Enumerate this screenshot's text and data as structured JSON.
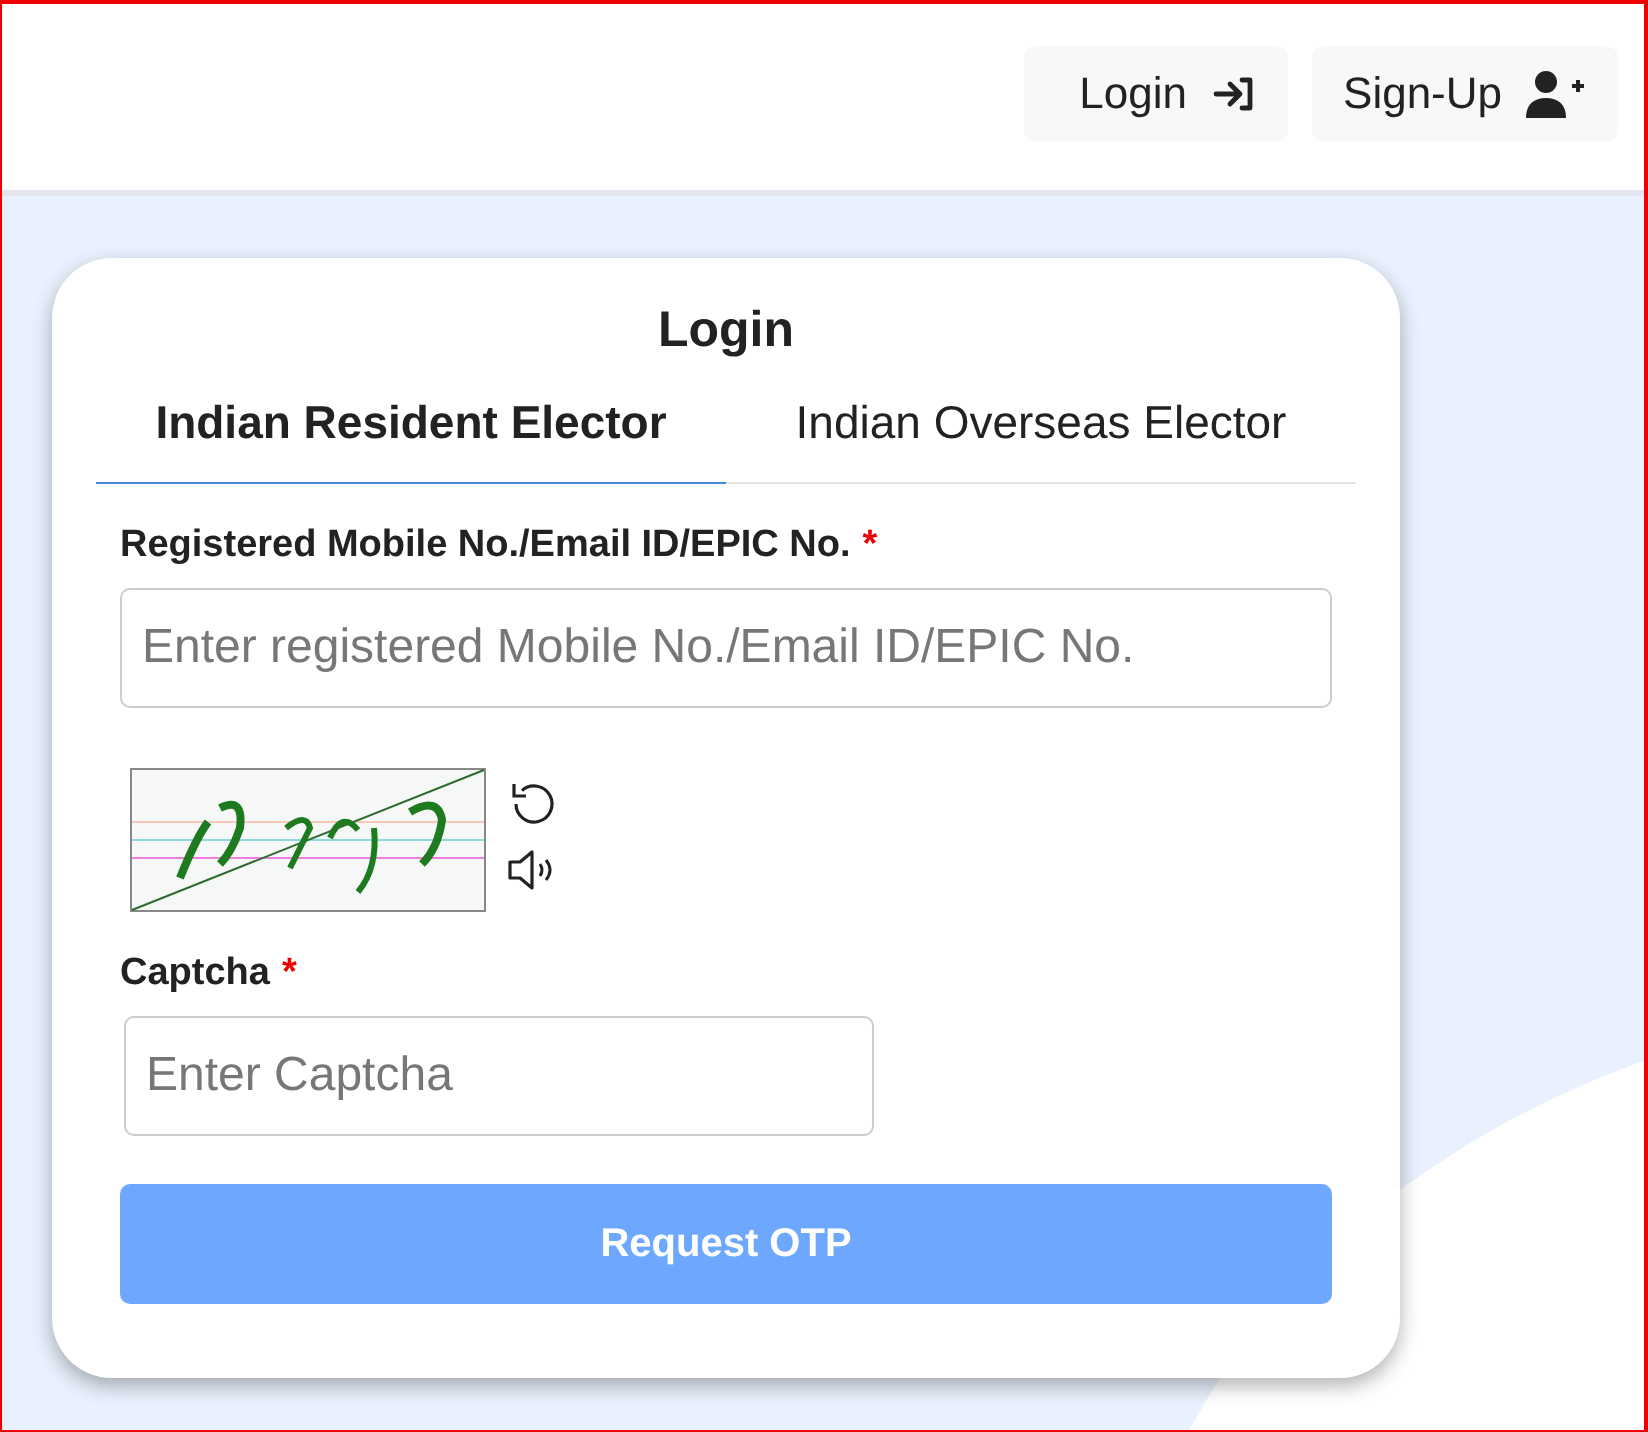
{
  "header": {
    "buttons": [
      {
        "label": "Login",
        "kind": "login"
      },
      {
        "label": "Sign-Up",
        "kind": "signup"
      }
    ]
  },
  "card": {
    "title": "Login",
    "tabs": [
      {
        "label": "Indian Resident Elector",
        "selected": true
      },
      {
        "label": "Indian Overseas Elector",
        "selected": false
      }
    ],
    "id_field": {
      "label": "Registered Mobile No./Email ID/EPIC No.",
      "required": "*",
      "placeholder": "Enter registered Mobile No./Email ID/EPIC No."
    },
    "captcha_field": {
      "label": "Captcha",
      "required": "*",
      "placeholder": "Enter Captcha"
    },
    "submit": {
      "label": "Request OTP",
      "disabled": true
    }
  }
}
